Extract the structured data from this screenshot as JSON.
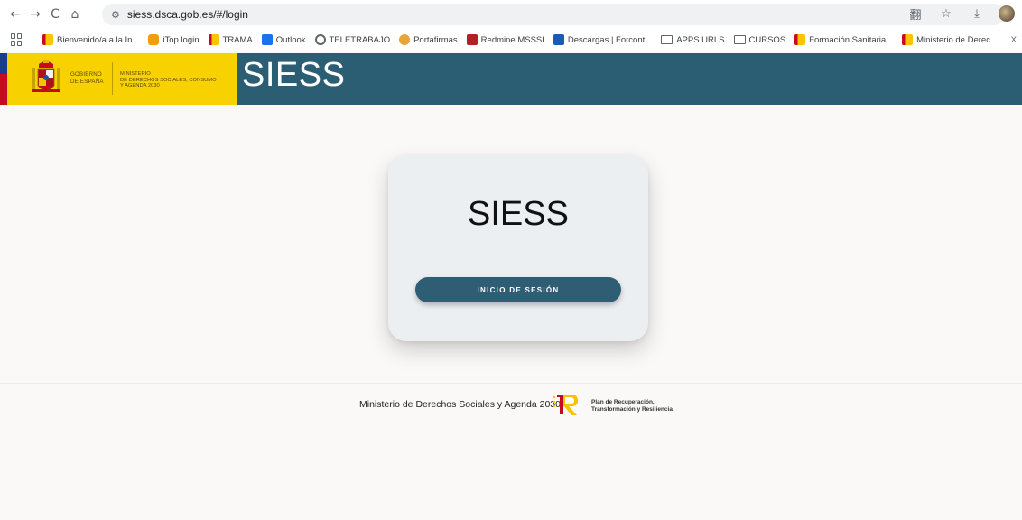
{
  "browser": {
    "url": "siess.dsca.gob.es/#/login",
    "nav": {
      "back_icon": "←",
      "forward_icon": "→",
      "reload_icon": "C",
      "home_icon": "⌂"
    },
    "site_info_icon": "⚙",
    "right_icons": {
      "translate": "翻",
      "star": "☆",
      "download": "⤓"
    }
  },
  "bookmarks": {
    "items": [
      {
        "label": "Bienvenido/a a la In...",
        "icon": "gov"
      },
      {
        "label": "iTop login",
        "icon": "itop"
      },
      {
        "label": "TRAMA",
        "icon": "gov"
      },
      {
        "label": "Outlook",
        "icon": "outlook"
      },
      {
        "label": "TELETRABAJO",
        "icon": "tele"
      },
      {
        "label": "Portafirmas",
        "icon": "porta"
      },
      {
        "label": "Redmine MSSSI",
        "icon": "redmine"
      },
      {
        "label": "Descargas | Forcont...",
        "icon": "forcont"
      },
      {
        "label": "APPS URLS",
        "icon": "folder"
      },
      {
        "label": "CURSOS",
        "icon": "folder"
      },
      {
        "label": "Formación Sanitaria...",
        "icon": "gov"
      },
      {
        "label": "Ministerio de Derec...",
        "icon": "gov"
      }
    ],
    "close": "X"
  },
  "header": {
    "gov_line1": "GOBIERNO",
    "gov_line2": "DE ESPAÑA",
    "ministry_line1": "MINISTERIO",
    "ministry_line2": "DE DERECHOS SOCIALES, CONSUMO",
    "ministry_line3": "Y AGENDA 2030",
    "title": "SIESS"
  },
  "card": {
    "title": "SIESS",
    "button_label": "INICIO DE SESIÓN"
  },
  "footer": {
    "text": "Ministerio de Derechos Sociales y Agenda 2030",
    "logo_line1": "Plan de Recuperación,",
    "logo_line2": "Transformación y Resiliencia"
  },
  "colors": {
    "header_bg": "#2b5d73",
    "gov_yellow": "#f8d100",
    "button_bg": "#2f5d73",
    "page_bg": "#faf9f7"
  }
}
